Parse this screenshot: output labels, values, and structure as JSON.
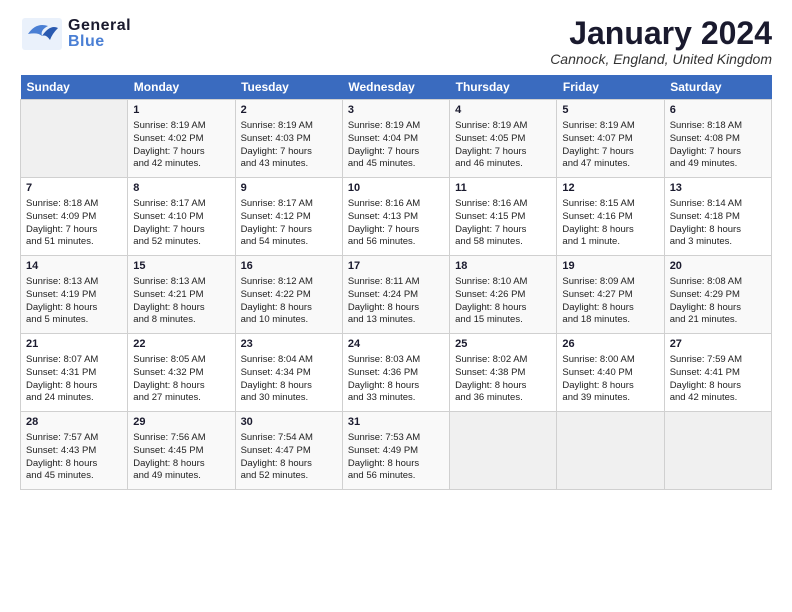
{
  "header": {
    "logo_general": "General",
    "logo_blue": "Blue",
    "month_title": "January 2024",
    "location": "Cannock, England, United Kingdom"
  },
  "days_of_week": [
    "Sunday",
    "Monday",
    "Tuesday",
    "Wednesday",
    "Thursday",
    "Friday",
    "Saturday"
  ],
  "weeks": [
    [
      {
        "day": "",
        "lines": []
      },
      {
        "day": "1",
        "lines": [
          "Sunrise: 8:19 AM",
          "Sunset: 4:02 PM",
          "Daylight: 7 hours",
          "and 42 minutes."
        ]
      },
      {
        "day": "2",
        "lines": [
          "Sunrise: 8:19 AM",
          "Sunset: 4:03 PM",
          "Daylight: 7 hours",
          "and 43 minutes."
        ]
      },
      {
        "day": "3",
        "lines": [
          "Sunrise: 8:19 AM",
          "Sunset: 4:04 PM",
          "Daylight: 7 hours",
          "and 45 minutes."
        ]
      },
      {
        "day": "4",
        "lines": [
          "Sunrise: 8:19 AM",
          "Sunset: 4:05 PM",
          "Daylight: 7 hours",
          "and 46 minutes."
        ]
      },
      {
        "day": "5",
        "lines": [
          "Sunrise: 8:19 AM",
          "Sunset: 4:07 PM",
          "Daylight: 7 hours",
          "and 47 minutes."
        ]
      },
      {
        "day": "6",
        "lines": [
          "Sunrise: 8:18 AM",
          "Sunset: 4:08 PM",
          "Daylight: 7 hours",
          "and 49 minutes."
        ]
      }
    ],
    [
      {
        "day": "7",
        "lines": [
          "Sunrise: 8:18 AM",
          "Sunset: 4:09 PM",
          "Daylight: 7 hours",
          "and 51 minutes."
        ]
      },
      {
        "day": "8",
        "lines": [
          "Sunrise: 8:17 AM",
          "Sunset: 4:10 PM",
          "Daylight: 7 hours",
          "and 52 minutes."
        ]
      },
      {
        "day": "9",
        "lines": [
          "Sunrise: 8:17 AM",
          "Sunset: 4:12 PM",
          "Daylight: 7 hours",
          "and 54 minutes."
        ]
      },
      {
        "day": "10",
        "lines": [
          "Sunrise: 8:16 AM",
          "Sunset: 4:13 PM",
          "Daylight: 7 hours",
          "and 56 minutes."
        ]
      },
      {
        "day": "11",
        "lines": [
          "Sunrise: 8:16 AM",
          "Sunset: 4:15 PM",
          "Daylight: 7 hours",
          "and 58 minutes."
        ]
      },
      {
        "day": "12",
        "lines": [
          "Sunrise: 8:15 AM",
          "Sunset: 4:16 PM",
          "Daylight: 8 hours",
          "and 1 minute."
        ]
      },
      {
        "day": "13",
        "lines": [
          "Sunrise: 8:14 AM",
          "Sunset: 4:18 PM",
          "Daylight: 8 hours",
          "and 3 minutes."
        ]
      }
    ],
    [
      {
        "day": "14",
        "lines": [
          "Sunrise: 8:13 AM",
          "Sunset: 4:19 PM",
          "Daylight: 8 hours",
          "and 5 minutes."
        ]
      },
      {
        "day": "15",
        "lines": [
          "Sunrise: 8:13 AM",
          "Sunset: 4:21 PM",
          "Daylight: 8 hours",
          "and 8 minutes."
        ]
      },
      {
        "day": "16",
        "lines": [
          "Sunrise: 8:12 AM",
          "Sunset: 4:22 PM",
          "Daylight: 8 hours",
          "and 10 minutes."
        ]
      },
      {
        "day": "17",
        "lines": [
          "Sunrise: 8:11 AM",
          "Sunset: 4:24 PM",
          "Daylight: 8 hours",
          "and 13 minutes."
        ]
      },
      {
        "day": "18",
        "lines": [
          "Sunrise: 8:10 AM",
          "Sunset: 4:26 PM",
          "Daylight: 8 hours",
          "and 15 minutes."
        ]
      },
      {
        "day": "19",
        "lines": [
          "Sunrise: 8:09 AM",
          "Sunset: 4:27 PM",
          "Daylight: 8 hours",
          "and 18 minutes."
        ]
      },
      {
        "day": "20",
        "lines": [
          "Sunrise: 8:08 AM",
          "Sunset: 4:29 PM",
          "Daylight: 8 hours",
          "and 21 minutes."
        ]
      }
    ],
    [
      {
        "day": "21",
        "lines": [
          "Sunrise: 8:07 AM",
          "Sunset: 4:31 PM",
          "Daylight: 8 hours",
          "and 24 minutes."
        ]
      },
      {
        "day": "22",
        "lines": [
          "Sunrise: 8:05 AM",
          "Sunset: 4:32 PM",
          "Daylight: 8 hours",
          "and 27 minutes."
        ]
      },
      {
        "day": "23",
        "lines": [
          "Sunrise: 8:04 AM",
          "Sunset: 4:34 PM",
          "Daylight: 8 hours",
          "and 30 minutes."
        ]
      },
      {
        "day": "24",
        "lines": [
          "Sunrise: 8:03 AM",
          "Sunset: 4:36 PM",
          "Daylight: 8 hours",
          "and 33 minutes."
        ]
      },
      {
        "day": "25",
        "lines": [
          "Sunrise: 8:02 AM",
          "Sunset: 4:38 PM",
          "Daylight: 8 hours",
          "and 36 minutes."
        ]
      },
      {
        "day": "26",
        "lines": [
          "Sunrise: 8:00 AM",
          "Sunset: 4:40 PM",
          "Daylight: 8 hours",
          "and 39 minutes."
        ]
      },
      {
        "day": "27",
        "lines": [
          "Sunrise: 7:59 AM",
          "Sunset: 4:41 PM",
          "Daylight: 8 hours",
          "and 42 minutes."
        ]
      }
    ],
    [
      {
        "day": "28",
        "lines": [
          "Sunrise: 7:57 AM",
          "Sunset: 4:43 PM",
          "Daylight: 8 hours",
          "and 45 minutes."
        ]
      },
      {
        "day": "29",
        "lines": [
          "Sunrise: 7:56 AM",
          "Sunset: 4:45 PM",
          "Daylight: 8 hours",
          "and 49 minutes."
        ]
      },
      {
        "day": "30",
        "lines": [
          "Sunrise: 7:54 AM",
          "Sunset: 4:47 PM",
          "Daylight: 8 hours",
          "and 52 minutes."
        ]
      },
      {
        "day": "31",
        "lines": [
          "Sunrise: 7:53 AM",
          "Sunset: 4:49 PM",
          "Daylight: 8 hours",
          "and 56 minutes."
        ]
      },
      {
        "day": "",
        "lines": []
      },
      {
        "day": "",
        "lines": []
      },
      {
        "day": "",
        "lines": []
      }
    ]
  ]
}
